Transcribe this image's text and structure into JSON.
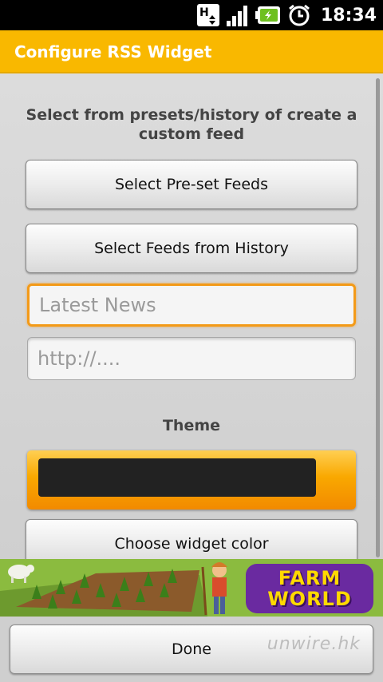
{
  "status_bar": {
    "time": "18:34",
    "icons": [
      "hsdpa-icon",
      "signal-icon",
      "battery-icon",
      "alarm-icon"
    ]
  },
  "title_bar": {
    "title": "Configure RSS Widget",
    "color": "#f9b800"
  },
  "main": {
    "intro": "Select from presets/history of create a custom feed",
    "preset_button": "Select Pre-set Feeds",
    "history_button": "Select Feeds from History",
    "feed_name_placeholder": "Latest News",
    "feed_url_placeholder": "http://....",
    "theme_label": "Theme",
    "theme_color": "#222222",
    "color_button": "Choose widget color"
  },
  "ad": {
    "line1": "FARM",
    "line2": "WORLD"
  },
  "bottom": {
    "done_button": "Done",
    "watermark": "unwire.hk"
  }
}
